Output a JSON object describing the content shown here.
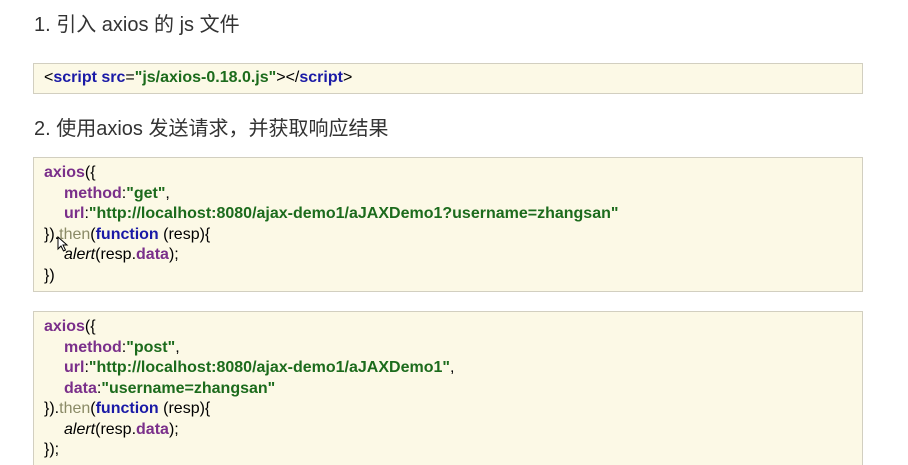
{
  "headings": {
    "h1": "1. 引入 axios 的 js 文件",
    "h2": "2. 使用axios 发送请求，并获取响应结果"
  },
  "snippet1": {
    "lt": "<",
    "tag": "script",
    "attr": "src",
    "eq": "=",
    "value": "\"js/axios-0.18.0.js\"",
    "mid": "></",
    "tag_close": "script",
    "gt": ">"
  },
  "snippet2": {
    "l1_fn": "axios",
    "l1_rest": "({",
    "l2_key": "method",
    "l2_colon": ":",
    "l2_val": "\"get\"",
    "l2_end": ",",
    "l3_key": "url",
    "l3_colon": ":",
    "l3_val": "\"http://localhost:8080/ajax-demo1/aJAXDemo1?username=zhangsan\"",
    "l4_start": "}).",
    "l4_then": "then",
    "l4_paren": "(",
    "l4_fn": "function",
    "l4_rest": " (resp){",
    "l5_alert": "alert",
    "l5_mid": "(resp.",
    "l5_data": "data",
    "l5_end": ");",
    "l6": "})"
  },
  "snippet3": {
    "l1_fn": "axios",
    "l1_rest": "({",
    "l2_key": "method",
    "l2_colon": ":",
    "l2_val": "\"post\"",
    "l2_end": ",",
    "l3_key": "url",
    "l3_colon": ":",
    "l3_val": "\"http://localhost:8080/ajax-demo1/aJAXDemo1\"",
    "l3_end": ",",
    "l4_key": "data",
    "l4_colon": ":",
    "l4_val": "\"username=zhangsan\"",
    "l5_start": "}).",
    "l5_then": "then",
    "l5_paren": "(",
    "l5_fn": "function",
    "l5_rest": " (resp){",
    "l6_alert": "alert",
    "l6_mid": "(resp.",
    "l6_data": "data",
    "l6_end": ");",
    "l7": "});"
  },
  "colors": {
    "keyword": "#7a2f8a",
    "blue": "#1a1aa6",
    "string": "#1c6b1c",
    "code_background": "#fcf9e6"
  },
  "icons": {
    "cursor": "mouse-pointer-icon"
  }
}
